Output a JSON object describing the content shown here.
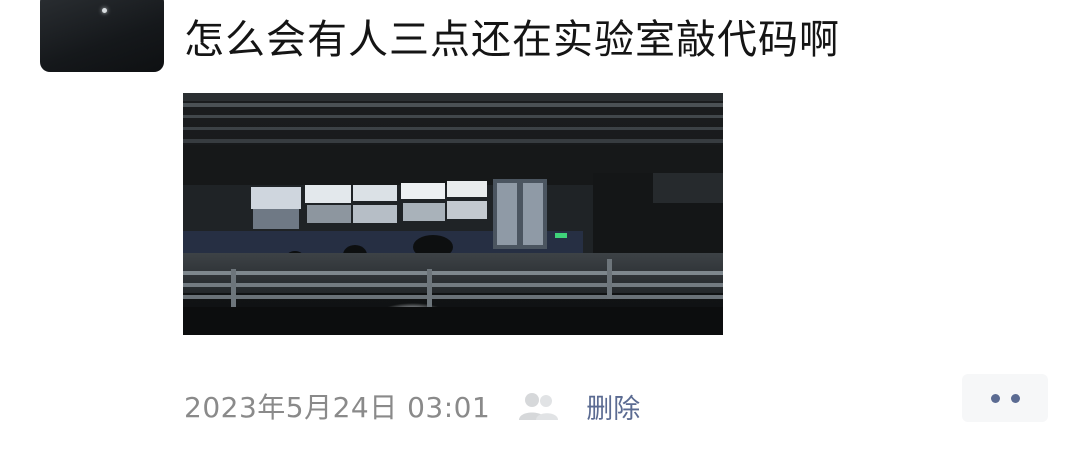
{
  "post": {
    "text": "怎么会有人三点还在实验室敲代码啊",
    "timestamp": "2023年5月24日  03:01",
    "visibility_icon": "group-icon",
    "delete_label": "删除",
    "more_icon": "more-dots-icon"
  },
  "avatar": {
    "icon": "night-sky-avatar"
  },
  "photo": {
    "subject": "dark-lab-building-at-night"
  },
  "colors": {
    "text": "#151515",
    "timestamp": "#8a8a8a",
    "link": "#5b6b92",
    "more_bg": "#f6f7f8"
  }
}
